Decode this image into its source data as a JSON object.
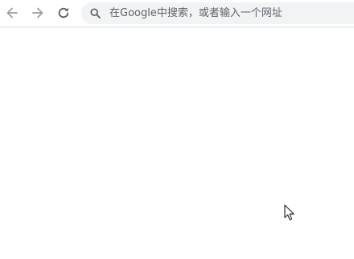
{
  "browser": {
    "toolbar": {
      "back_icon": "arrow-left-icon",
      "forward_icon": "arrow-right-icon",
      "reload_icon": "reload-icon"
    },
    "omnibox": {
      "icon": "search-icon",
      "placeholder": "在Google中搜索，或者输入一个网址",
      "value": ""
    }
  },
  "colors": {
    "icon_disabled": "#9aa0a6",
    "icon_active": "#5f6368",
    "omnibox_bg": "#f1f3f4",
    "page_bg": "#ffffff"
  }
}
